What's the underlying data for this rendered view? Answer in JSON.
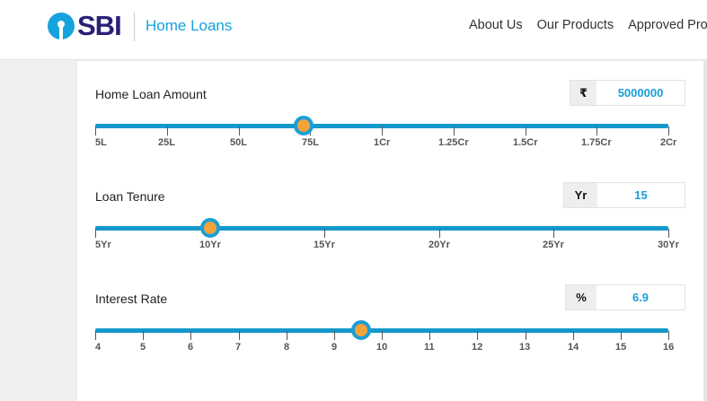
{
  "header": {
    "logo_text": "SBI",
    "subtitle": "Home Loans",
    "nav": [
      "About Us",
      "Our Products",
      "Approved Proje"
    ]
  },
  "amount": {
    "label": "Home Loan Amount",
    "unit": "₹",
    "value": "5000000",
    "ticks": [
      "5L",
      "25L",
      "50L",
      "75L",
      "1Cr",
      "1.25Cr",
      "1.5Cr",
      "1.75Cr",
      "2Cr"
    ],
    "slider_fraction": 0.364
  },
  "tenure": {
    "label": "Loan Tenure",
    "unit": "Yr",
    "value": "15",
    "ticks": [
      "5Yr",
      "10Yr",
      "15Yr",
      "20Yr",
      "25Yr",
      "30Yr"
    ],
    "slider_fraction": 0.2
  },
  "rate": {
    "label": "Interest Rate",
    "unit": "%",
    "value": "6.9",
    "ticks": [
      "4",
      "5",
      "6",
      "7",
      "8",
      "9",
      "10",
      "11",
      "12",
      "13",
      "14",
      "15",
      "16"
    ],
    "slider_fraction": 0.464
  },
  "colors": {
    "brand_blue": "#16a3dd",
    "brand_navy": "#292075",
    "thumb_fill": "#f2a33a"
  }
}
